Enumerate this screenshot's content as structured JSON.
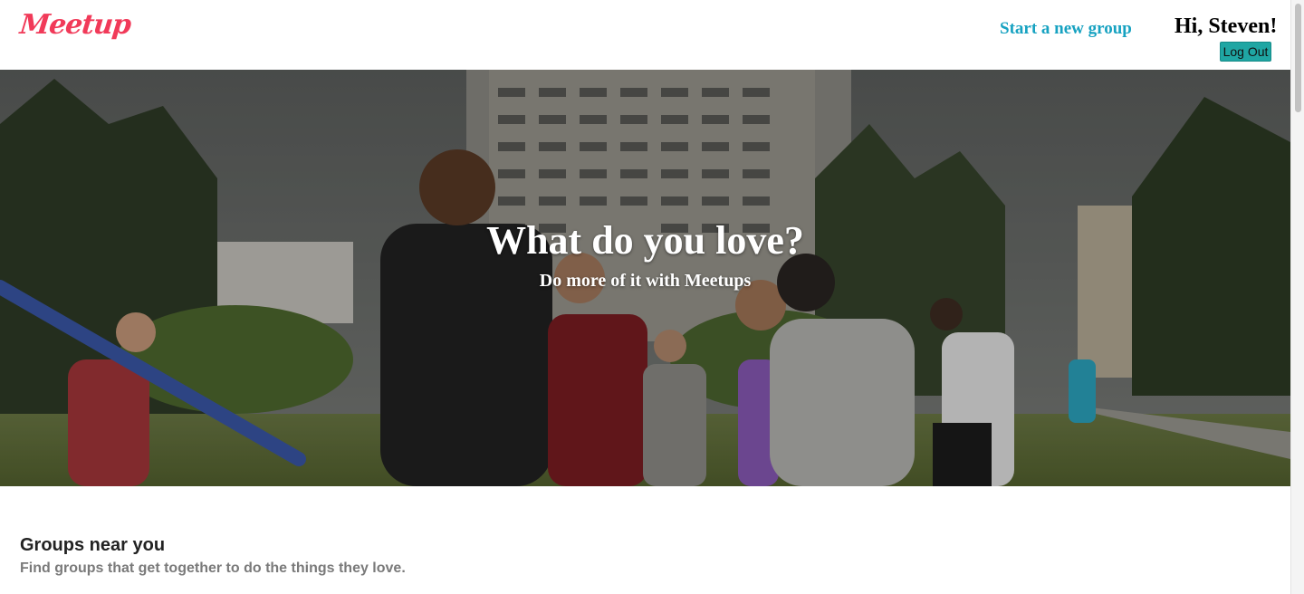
{
  "header": {
    "logo_text": "Meetup",
    "start_group_label": "Start a new group",
    "greeting": "Hi, Steven!",
    "logout_label": "Log Out"
  },
  "hero": {
    "title": "What do you love?",
    "subtitle": "Do more of it with Meetups",
    "image_name": "group-photo-background"
  },
  "groups": {
    "title": "Groups near you",
    "subtitle": "Find groups that get together to do the things they love."
  },
  "colors": {
    "brand": "#f13a59",
    "link": "#17a2c1",
    "logout_bg": "#1fa6a3"
  }
}
